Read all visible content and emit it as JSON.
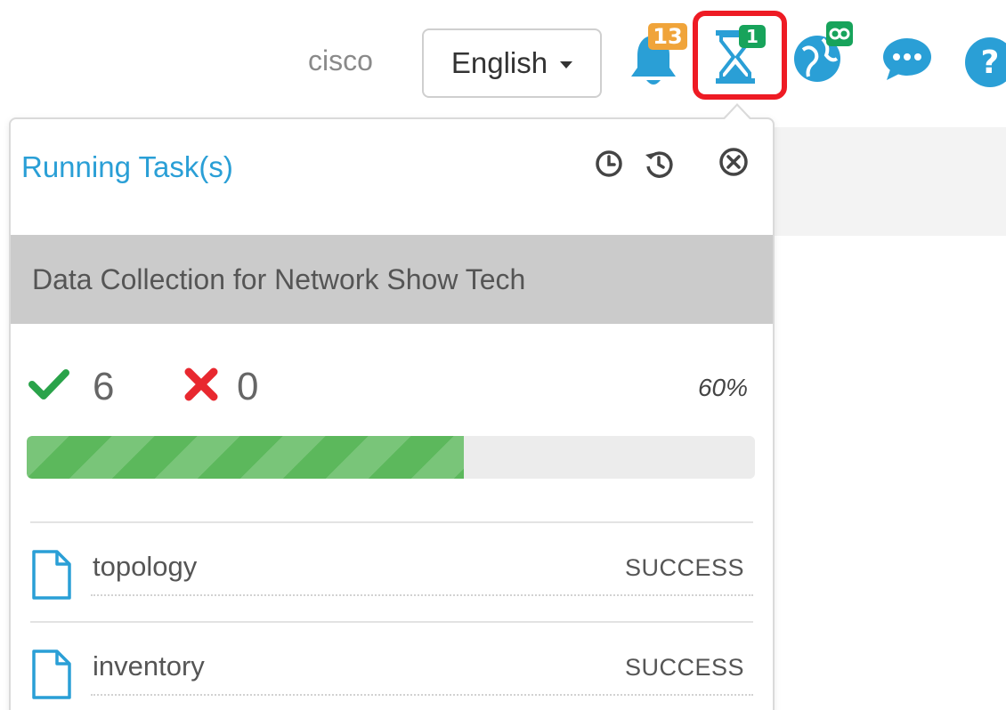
{
  "header": {
    "username": "cisco",
    "language": {
      "selected": "English"
    },
    "notifications": {
      "badge": "13",
      "icon": "bell-icon"
    },
    "tasks": {
      "badge": "1",
      "icon": "hourglass-icon",
      "highlighted": true,
      "highlight_color": "#ee1b24"
    },
    "globe": {
      "icon": "globe-link-icon"
    },
    "chat": {
      "icon": "chat-icon"
    },
    "help": {
      "icon": "help-icon"
    }
  },
  "popover": {
    "title": "Running Task(s)",
    "tools": [
      "clock-icon",
      "history-icon",
      "close-circle-icon"
    ],
    "task_name": "Data Collection for Network Show Tech",
    "success_count": "6",
    "failure_count": "0",
    "percent_label": "60%",
    "progress_fraction": 0.6,
    "items": [
      {
        "name": "topology",
        "status": "SUCCESS"
      },
      {
        "name": "inventory",
        "status": "SUCCESS"
      }
    ]
  },
  "colors": {
    "accent_blue": "#2a9fd6",
    "success_green": "#2aa34a",
    "failure_red": "#e8282f",
    "progress_green": "#5cb85c",
    "badge_orange": "#f0a43a",
    "badge_green": "#17a35b"
  }
}
